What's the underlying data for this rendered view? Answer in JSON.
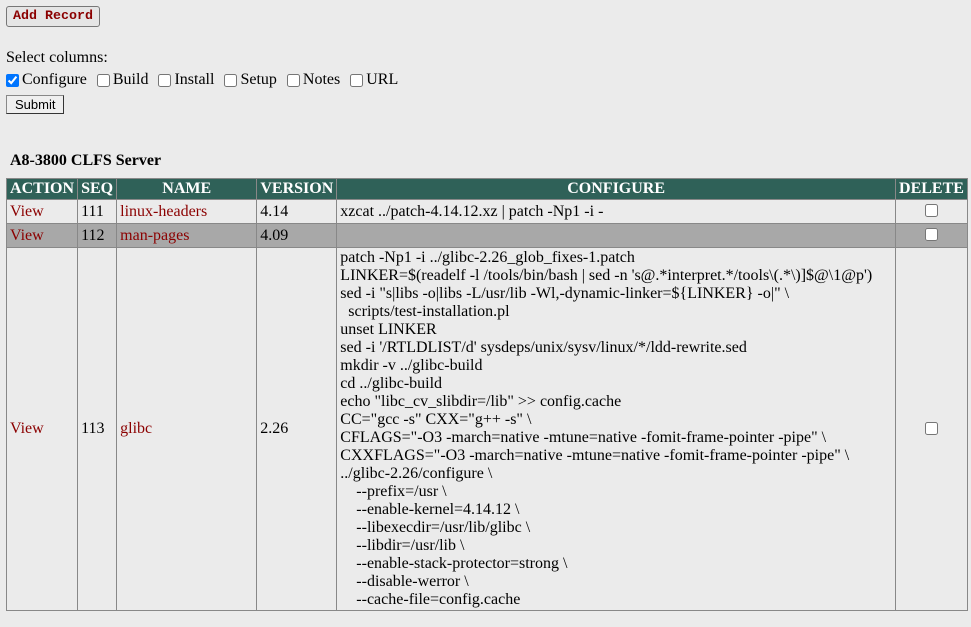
{
  "add_btn": "Add Record",
  "select_label": "Select columns:",
  "columns": [
    {
      "label": "Configure",
      "checked": true
    },
    {
      "label": "Build",
      "checked": false
    },
    {
      "label": "Install",
      "checked": false
    },
    {
      "label": "Setup",
      "checked": false
    },
    {
      "label": "Notes",
      "checked": false
    },
    {
      "label": "URL",
      "checked": false
    }
  ],
  "submit_label": "Submit",
  "page_title": "A8-3800 CLFS Server",
  "headers": {
    "action": "ACTION",
    "seq": "SEQ",
    "name": "NAME",
    "version": "VERSION",
    "configure": "CONFIGURE",
    "delete": "DELETE"
  },
  "rows": [
    {
      "action": "View",
      "seq": "111",
      "name": "linux-headers",
      "version": "4.14",
      "configure": "xzcat ../patch-4.14.12.xz | patch -Np1 -i -"
    },
    {
      "action": "View",
      "seq": "112",
      "name": "man-pages",
      "version": "4.09",
      "configure": ""
    },
    {
      "action": "View",
      "seq": "113",
      "name": "glibc",
      "version": "2.26",
      "configure": "patch -Np1 -i ../glibc-2.26_glob_fixes-1.patch\nLINKER=$(readelf -l /tools/bin/bash | sed -n 's@.*interpret.*/tools\\(.*\\)]$@\\1@p')\nsed -i \"s|libs -o|libs -L/usr/lib -Wl,-dynamic-linker=${LINKER} -o|\" \\\n  scripts/test-installation.pl\nunset LINKER\nsed -i '/RTLDLIST/d' sysdeps/unix/sysv/linux/*/ldd-rewrite.sed\nmkdir -v ../glibc-build\ncd ../glibc-build\necho \"libc_cv_slibdir=/lib\" >> config.cache\nCC=\"gcc -s\" CXX=\"g++ -s\" \\\nCFLAGS=\"-O3 -march=native -mtune=native -fomit-frame-pointer -pipe\" \\\nCXXFLAGS=\"-O3 -march=native -mtune=native -fomit-frame-pointer -pipe\" \\\n../glibc-2.26/configure \\\n    --prefix=/usr \\\n    --enable-kernel=4.14.12 \\\n    --libexecdir=/usr/lib/glibc \\\n    --libdir=/usr/lib \\\n    --enable-stack-protector=strong \\\n    --disable-werror \\\n    --cache-file=config.cache"
    }
  ]
}
